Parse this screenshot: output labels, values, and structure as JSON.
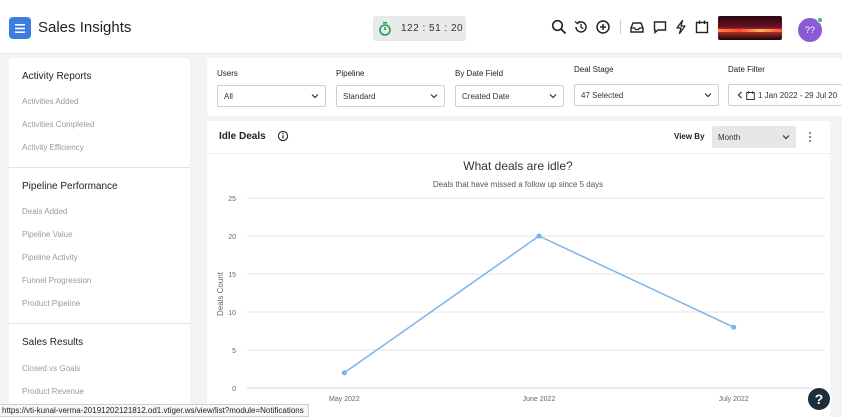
{
  "app": {
    "title": "Sales Insights"
  },
  "header": {
    "timer": "122 : 51 : 20",
    "avatar_initials": "??",
    "colors": {
      "menu_button": "#3d7ce0",
      "avatar": "#8a5bd6",
      "timer_icon": "#1ea34a"
    }
  },
  "sidebar": {
    "sections": [
      {
        "title": "Activity Reports",
        "items": [
          "Activities Added",
          "Activities Completed",
          "Activity Efficiency"
        ]
      },
      {
        "title": "Pipeline Performance",
        "items": [
          "Deals Added",
          "Pipeline Value",
          "Pipeline Activity",
          "Funnel Progression",
          "Product Pipeline"
        ]
      },
      {
        "title": "Sales Results",
        "items": [
          "Closed vs Goals",
          "Product Revenue"
        ]
      }
    ]
  },
  "filters": {
    "users": {
      "label": "Users",
      "value": "All"
    },
    "pipeline": {
      "label": "Pipeline",
      "value": "Standard"
    },
    "date_field": {
      "label": "By Date Field",
      "value": "Created Date"
    },
    "deal_stage": {
      "label": "Deal Stage",
      "value": "47 Selected"
    },
    "date_filter": {
      "label": "Date Filter",
      "value": "1 Jan 2022 - 29 Jul 20"
    }
  },
  "card": {
    "title": "Idle Deals",
    "view_by_label": "View By",
    "view_by_value": "Month"
  },
  "chart_data": {
    "type": "line",
    "title": "What deals are idle?",
    "subtitle": "Deals that have missed a follow up since 5 days",
    "ylabel": "Deals Count",
    "xlabel": "",
    "categories": [
      "May 2022",
      "June 2022",
      "July 2022"
    ],
    "values": [
      2,
      20,
      8
    ],
    "ylim": [
      0,
      25
    ],
    "yticks": [
      "0",
      "5",
      "10",
      "15",
      "20",
      "25"
    ],
    "grid": true,
    "line_color": "#7cb5ec"
  },
  "status": {
    "url": "https://vti-kunal-verma-20191202121812.od1.vtiger.ws/view/list?module=Notifications"
  },
  "help": {
    "label": "?"
  }
}
